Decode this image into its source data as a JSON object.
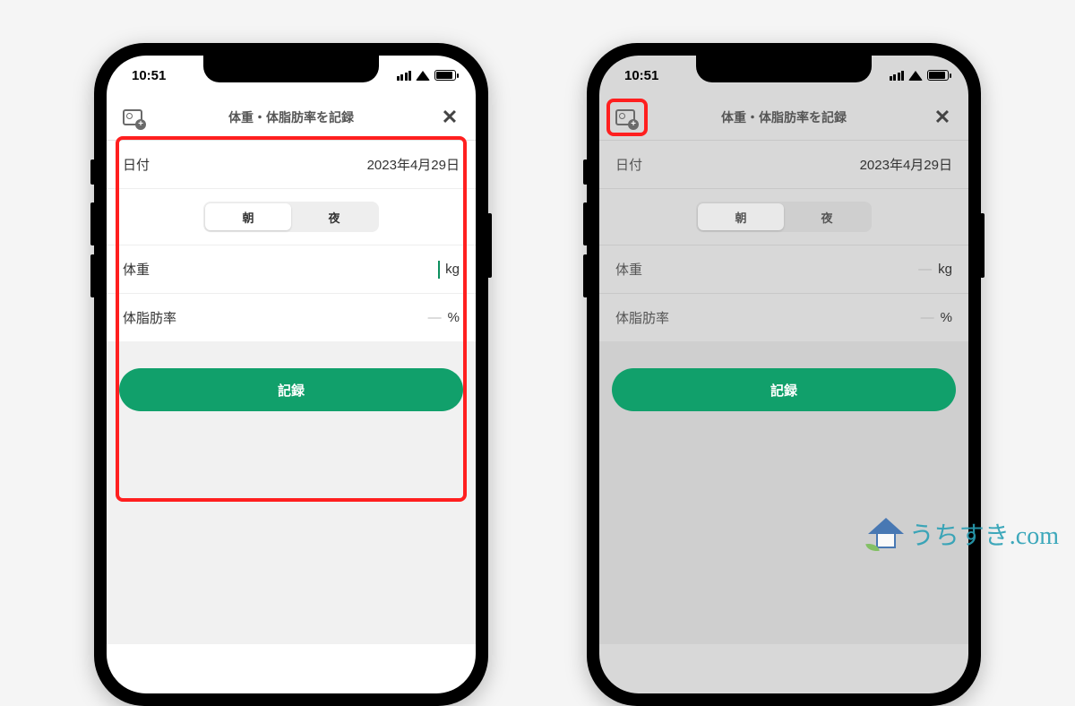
{
  "status": {
    "time": "10:51"
  },
  "titlebar": {
    "title": "体重・体脂肪率を記録"
  },
  "rows": {
    "date": {
      "label": "日付",
      "value": "2023年4月29日"
    },
    "weight": {
      "label": "体重",
      "placeholder": "―",
      "unit": "kg"
    },
    "bodyfat": {
      "label": "体脂肪率",
      "placeholder": "―",
      "unit": "%"
    }
  },
  "segmented": {
    "morning": "朝",
    "night": "夜"
  },
  "button": {
    "record": "記録"
  },
  "watermark": {
    "text": "うちすき.com"
  }
}
